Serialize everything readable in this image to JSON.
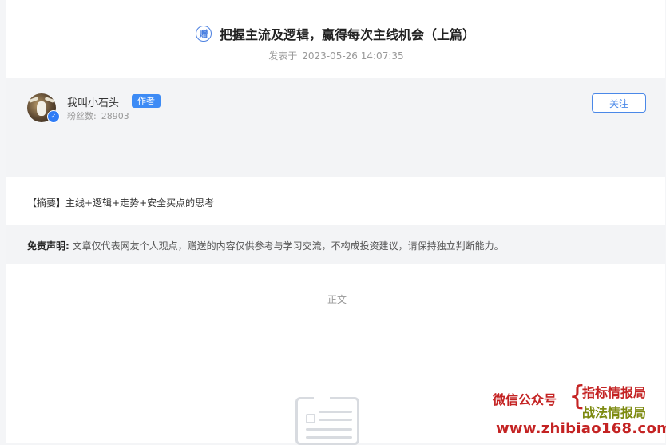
{
  "article": {
    "badge": "赠",
    "title": "把握主流及逻辑，赢得每次主线机会（上篇）",
    "published_prefix": "发表于",
    "published_time": "2023-05-26 14:07:35"
  },
  "author": {
    "name": "我叫小石头",
    "tag": "作者",
    "fans_label": "粉丝数:",
    "fans_count": "28903",
    "follow_label": "关注"
  },
  "summary": "【摘要】主线+逻辑+走势+安全买点的思考",
  "disclaimer": {
    "label": "免责声明:",
    "text": "文章仅代表网友个人观点，赠送的内容仅供参考与学习交流，不构成投资建议，请保持独立判断能力。"
  },
  "divider_label": "正文",
  "watermark": {
    "label": "微信公众号",
    "line1": "指标情报局",
    "line2": "战法情报局",
    "url": "www.zhibiao168.com"
  },
  "colors": {
    "accent": "#3d8bf5",
    "watermark_red": "#c42323",
    "watermark_olive": "#7d8a10"
  },
  "icons": [
    "zeng-badge-icon",
    "verified-icon",
    "document-placeholder-icon"
  ]
}
